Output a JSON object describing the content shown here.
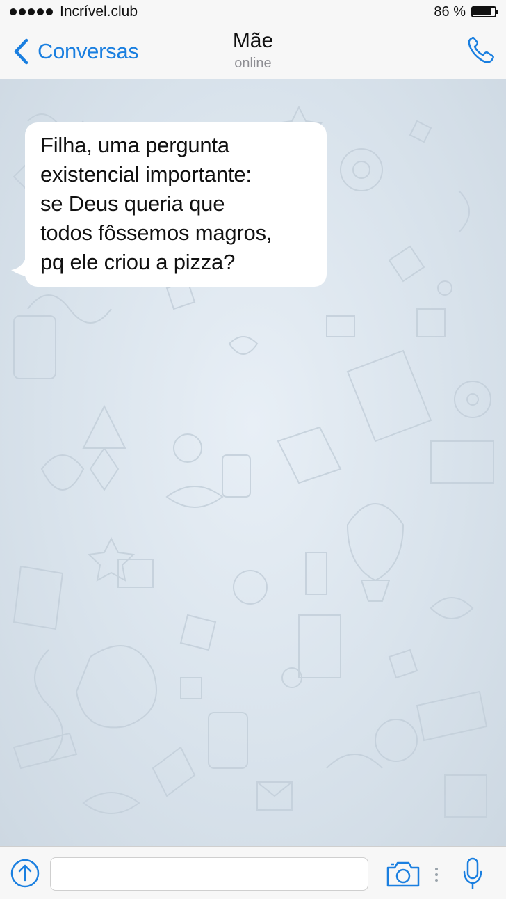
{
  "status_bar": {
    "carrier": "Incrível.club",
    "battery_percent": "86 %",
    "battery_level": 0.86,
    "signal_icon": "signal-dots-icon",
    "battery_icon": "battery-icon"
  },
  "nav": {
    "back_label": "Conversas",
    "title": "Mãe",
    "subtitle": "online",
    "back_icon": "chevron-left-icon",
    "call_icon": "phone-icon"
  },
  "messages": [
    {
      "direction": "incoming",
      "text": "Filha, uma pergunta\nexistencial importante:\nse Deus queria que\ntodos fôssemos magros,\npq ele criou a pizza?"
    }
  ],
  "input_bar": {
    "placeholder": "",
    "value": "",
    "attach_icon": "arrow-up-circle-icon",
    "camera_icon": "camera-icon",
    "mic_icon": "microphone-icon"
  },
  "colors": {
    "accent": "#1a7fe0",
    "bar_background": "#f7f7f7",
    "chat_background": "#dbe4ed",
    "bubble_incoming": "#ffffff"
  }
}
